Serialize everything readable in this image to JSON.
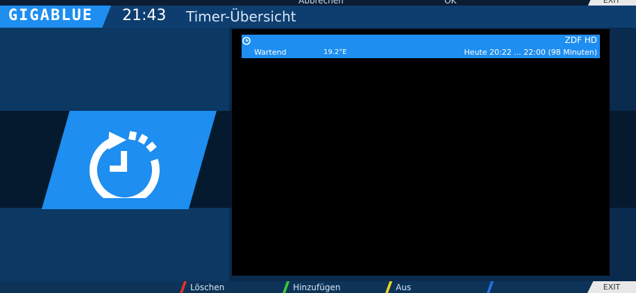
{
  "top_hints": {
    "red_label": "Abbrechen",
    "green_label": "OK",
    "exit_label": "EXIT"
  },
  "header": {
    "brand": "GIGABLUE",
    "clock": "21:43",
    "title": "Timer-Übersicht"
  },
  "timers": [
    {
      "channel": "ZDF HD",
      "status": "Wartend",
      "position": "19.2°E",
      "time": "Heute 20:22 ... 22:00 (98 Minuten)",
      "icon": "clock-icon"
    }
  ],
  "footer": {
    "red_label": "Löschen",
    "green_label": "Hinzufügen",
    "yellow_label": "Aus",
    "blue_label": "",
    "exit_label": "EXIT"
  },
  "colors": {
    "accent": "#1e8ef0",
    "red": "#e53030",
    "green": "#38c838",
    "yellow": "#e8d420",
    "blue": "#2a6fe0"
  }
}
